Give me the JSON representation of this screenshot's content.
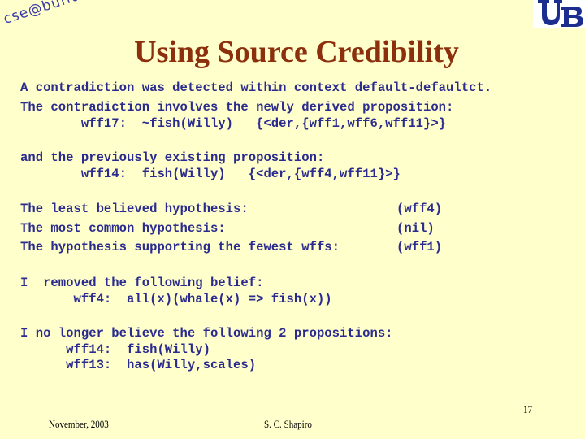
{
  "header": {
    "logo_text": "cse@buffalo",
    "brand_logo": "ub-logo",
    "title": "Using Source Credibility"
  },
  "body": {
    "contradiction": {
      "line1": "A contradiction was detected within context default-defaultct.",
      "line2": "The contradiction involves the newly derived proposition:",
      "line3": "        wff17:  ~fish(Willy)   {<der,{wff1,wff6,wff11}>}"
    },
    "existing": {
      "line1": "and the previously existing proposition:",
      "line2": "        wff14:  fish(Willy)   {<der,{wff4,wff11}>}"
    },
    "hypotheses": [
      {
        "label": "The least believed hypothesis:",
        "value": "(wff4)"
      },
      {
        "label": "The most common hypothesis:",
        "value": "(nil)"
      },
      {
        "label": "The hypothesis supporting the fewest wffs:",
        "value": "(wff1)"
      }
    ],
    "removed": {
      "line1": "I  removed the following belief:",
      "line2": "       wff4:  all(x)(whale(x) => fish(x))"
    },
    "no_longer": {
      "line1": "I no longer believe the following 2 propositions:",
      "line2": "      wff14:  fish(Willy)",
      "line3": "      wff13:  has(Willy,scales)"
    }
  },
  "footer": {
    "date": "November, 2003",
    "author": "S. C. Shapiro",
    "page_number": "17"
  }
}
